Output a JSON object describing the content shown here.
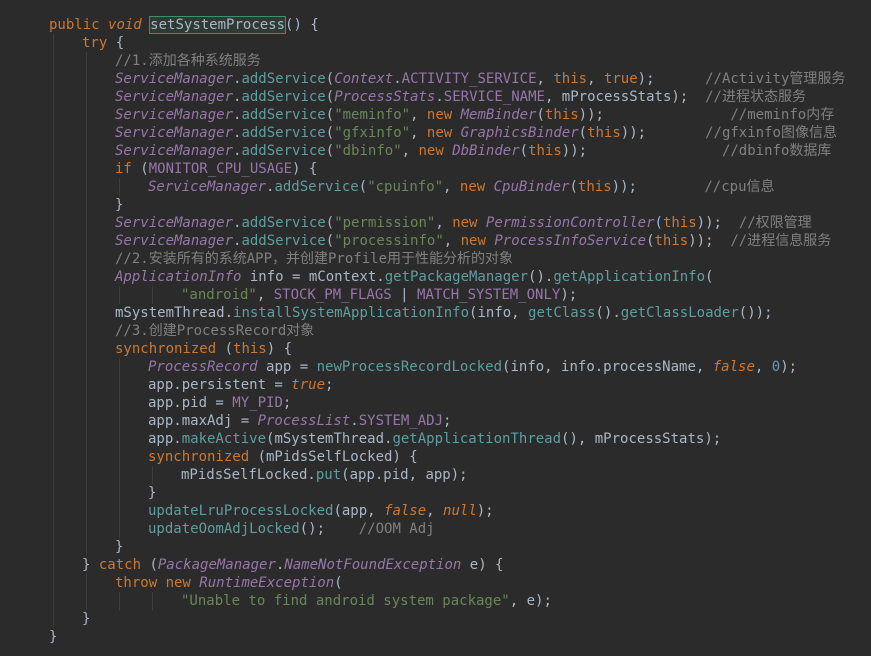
{
  "editor": {
    "background": "#2b2b2b",
    "colors": {
      "keyword": "#cc7832",
      "class": "#9876aa",
      "method": "#5f9ea0",
      "string": "#6a8759",
      "comment": "#808080",
      "number": "#6897bb",
      "plain": "#a9b7c6"
    },
    "lines": [
      {
        "indent": 0,
        "tokens": [
          [
            "kw",
            "public "
          ],
          [
            "kwi",
            "void "
          ],
          [
            "hl",
            "setSystemProcess"
          ],
          [
            "plain",
            "() {"
          ]
        ]
      },
      {
        "indent": 1,
        "tokens": [
          [
            "kw",
            "try "
          ],
          [
            "plain",
            "{"
          ]
        ]
      },
      {
        "indent": 2,
        "tokens": [
          [
            "cmt",
            "//1.添加各种系统服务"
          ]
        ]
      },
      {
        "indent": 2,
        "tokens": [
          [
            "cls",
            "ServiceManager"
          ],
          [
            "plain",
            "."
          ],
          [
            "meth",
            "addService"
          ],
          [
            "plain",
            "("
          ],
          [
            "cls",
            "Context"
          ],
          [
            "plain",
            "."
          ],
          [
            "const",
            "ACTIVITY_SERVICE"
          ],
          [
            "plain",
            ", "
          ],
          [
            "kw",
            "this"
          ],
          [
            "plain",
            ", "
          ],
          [
            "kw",
            "true"
          ],
          [
            "plain",
            ");      "
          ],
          [
            "cmt",
            "//Activity管理服务"
          ]
        ]
      },
      {
        "indent": 2,
        "tokens": [
          [
            "cls",
            "ServiceManager"
          ],
          [
            "plain",
            "."
          ],
          [
            "meth",
            "addService"
          ],
          [
            "plain",
            "("
          ],
          [
            "cls",
            "ProcessStats"
          ],
          [
            "plain",
            "."
          ],
          [
            "const",
            "SERVICE_NAME"
          ],
          [
            "plain",
            ", mProcessStats);  "
          ],
          [
            "cmt",
            "//进程状态服务"
          ]
        ]
      },
      {
        "indent": 2,
        "tokens": [
          [
            "cls",
            "ServiceManager"
          ],
          [
            "plain",
            "."
          ],
          [
            "meth",
            "addService"
          ],
          [
            "plain",
            "("
          ],
          [
            "str",
            "\"meminfo\""
          ],
          [
            "plain",
            ", "
          ],
          [
            "kw",
            "new "
          ],
          [
            "cls",
            "MemBinder"
          ],
          [
            "plain",
            "("
          ],
          [
            "kw",
            "this"
          ],
          [
            "plain",
            "));               "
          ],
          [
            "cmt",
            "//meminfo内存"
          ]
        ]
      },
      {
        "indent": 2,
        "tokens": [
          [
            "cls",
            "ServiceManager"
          ],
          [
            "plain",
            "."
          ],
          [
            "meth",
            "addService"
          ],
          [
            "plain",
            "("
          ],
          [
            "str",
            "\"gfxinfo\""
          ],
          [
            "plain",
            ", "
          ],
          [
            "kw",
            "new "
          ],
          [
            "cls",
            "GraphicsBinder"
          ],
          [
            "plain",
            "("
          ],
          [
            "kw",
            "this"
          ],
          [
            "plain",
            "));       "
          ],
          [
            "cmt",
            "//gfxinfo图像信息"
          ]
        ]
      },
      {
        "indent": 2,
        "tokens": [
          [
            "cls",
            "ServiceManager"
          ],
          [
            "plain",
            "."
          ],
          [
            "meth",
            "addService"
          ],
          [
            "plain",
            "("
          ],
          [
            "str",
            "\"dbinfo\""
          ],
          [
            "plain",
            ", "
          ],
          [
            "kw",
            "new "
          ],
          [
            "cls",
            "DbBinder"
          ],
          [
            "plain",
            "("
          ],
          [
            "kw",
            "this"
          ],
          [
            "plain",
            "));                "
          ],
          [
            "cmt",
            "//dbinfo数据库"
          ]
        ]
      },
      {
        "indent": 2,
        "tokens": [
          [
            "kw",
            "if "
          ],
          [
            "plain",
            "("
          ],
          [
            "const",
            "MONITOR_CPU_USAGE"
          ],
          [
            "plain",
            ") {"
          ]
        ]
      },
      {
        "indent": 3,
        "tokens": [
          [
            "cls",
            "ServiceManager"
          ],
          [
            "plain",
            "."
          ],
          [
            "meth",
            "addService"
          ],
          [
            "plain",
            "("
          ],
          [
            "str",
            "\"cpuinfo\""
          ],
          [
            "plain",
            ", "
          ],
          [
            "kw",
            "new "
          ],
          [
            "cls",
            "CpuBinder"
          ],
          [
            "plain",
            "("
          ],
          [
            "kw",
            "this"
          ],
          [
            "plain",
            "));        "
          ],
          [
            "cmt",
            "//cpu信息"
          ]
        ]
      },
      {
        "indent": 2,
        "tokens": [
          [
            "plain",
            "}"
          ]
        ]
      },
      {
        "indent": 2,
        "tokens": [
          [
            "cls",
            "ServiceManager"
          ],
          [
            "plain",
            "."
          ],
          [
            "meth",
            "addService"
          ],
          [
            "plain",
            "("
          ],
          [
            "str",
            "\"permission\""
          ],
          [
            "plain",
            ", "
          ],
          [
            "kw",
            "new "
          ],
          [
            "cls",
            "PermissionController"
          ],
          [
            "plain",
            "("
          ],
          [
            "kw",
            "this"
          ],
          [
            "plain",
            "));  "
          ],
          [
            "cmt",
            "//权限管理"
          ]
        ]
      },
      {
        "indent": 2,
        "tokens": [
          [
            "cls",
            "ServiceManager"
          ],
          [
            "plain",
            "."
          ],
          [
            "meth",
            "addService"
          ],
          [
            "plain",
            "("
          ],
          [
            "str",
            "\"processinfo\""
          ],
          [
            "plain",
            ", "
          ],
          [
            "kw",
            "new "
          ],
          [
            "cls",
            "ProcessInfoService"
          ],
          [
            "plain",
            "("
          ],
          [
            "kw",
            "this"
          ],
          [
            "plain",
            "));  "
          ],
          [
            "cmt",
            "//进程信息服务"
          ]
        ]
      },
      {
        "indent": 2,
        "tokens": [
          [
            "cmt",
            "//2.安装所有的系统APP，并创建Profile用于性能分析的对象"
          ]
        ]
      },
      {
        "indent": 2,
        "tokens": [
          [
            "cls",
            "ApplicationInfo "
          ],
          [
            "plain",
            "info = mContext."
          ],
          [
            "meth",
            "getPackageManager"
          ],
          [
            "plain",
            "()."
          ],
          [
            "meth",
            "getApplicationInfo"
          ],
          [
            "plain",
            "("
          ]
        ]
      },
      {
        "indent": 4,
        "tokens": [
          [
            "str",
            "\"android\""
          ],
          [
            "plain",
            ", "
          ],
          [
            "const",
            "STOCK_PM_FLAGS"
          ],
          [
            "plain",
            " | "
          ],
          [
            "const",
            "MATCH_SYSTEM_ONLY"
          ],
          [
            "plain",
            ");"
          ]
        ]
      },
      {
        "indent": 2,
        "tokens": [
          [
            "plain",
            "mSystemThread."
          ],
          [
            "meth",
            "installSystemApplicationInfo"
          ],
          [
            "plain",
            "(info, "
          ],
          [
            "meth",
            "getClass"
          ],
          [
            "plain",
            "()."
          ],
          [
            "meth",
            "getClassLoader"
          ],
          [
            "plain",
            "());"
          ]
        ]
      },
      {
        "indent": 2,
        "tokens": [
          [
            "cmt",
            "//3.创建ProcessRecord对象"
          ]
        ]
      },
      {
        "indent": 2,
        "tokens": [
          [
            "kw",
            "synchronized "
          ],
          [
            "plain",
            "("
          ],
          [
            "kw",
            "this"
          ],
          [
            "plain",
            ") {"
          ]
        ]
      },
      {
        "indent": 3,
        "tokens": [
          [
            "cls",
            "ProcessRecord "
          ],
          [
            "plain",
            "app = "
          ],
          [
            "meth",
            "newProcessRecordLocked"
          ],
          [
            "plain",
            "(info, info.processName, "
          ],
          [
            "kwi",
            "false"
          ],
          [
            "plain",
            ", "
          ],
          [
            "num",
            "0"
          ],
          [
            "plain",
            ");"
          ]
        ]
      },
      {
        "indent": 3,
        "tokens": [
          [
            "plain",
            "app.persistent = "
          ],
          [
            "kwi",
            "true"
          ],
          [
            "plain",
            ";"
          ]
        ]
      },
      {
        "indent": 3,
        "tokens": [
          [
            "plain",
            "app.pid = "
          ],
          [
            "const",
            "MY_PID"
          ],
          [
            "plain",
            ";"
          ]
        ]
      },
      {
        "indent": 3,
        "tokens": [
          [
            "plain",
            "app.maxAdj = "
          ],
          [
            "cls",
            "ProcessList"
          ],
          [
            "plain",
            "."
          ],
          [
            "const",
            "SYSTEM_ADJ"
          ],
          [
            "plain",
            ";"
          ]
        ]
      },
      {
        "indent": 3,
        "tokens": [
          [
            "plain",
            "app."
          ],
          [
            "meth",
            "makeActive"
          ],
          [
            "plain",
            "(mSystemThread."
          ],
          [
            "meth",
            "getApplicationThread"
          ],
          [
            "plain",
            "(), mProcessStats);"
          ]
        ]
      },
      {
        "indent": 3,
        "tokens": [
          [
            "kw",
            "synchronized "
          ],
          [
            "plain",
            "(mPidsSelfLocked) {"
          ]
        ]
      },
      {
        "indent": 4,
        "tokens": [
          [
            "plain",
            "mPidsSelfLocked."
          ],
          [
            "meth",
            "put"
          ],
          [
            "plain",
            "(app.pid, app);"
          ]
        ]
      },
      {
        "indent": 3,
        "tokens": [
          [
            "plain",
            "}"
          ]
        ]
      },
      {
        "indent": 3,
        "tokens": [
          [
            "meth",
            "updateLruProcessLocked"
          ],
          [
            "plain",
            "(app, "
          ],
          [
            "kwi",
            "false"
          ],
          [
            "plain",
            ", "
          ],
          [
            "kwi",
            "null"
          ],
          [
            "plain",
            ");"
          ]
        ]
      },
      {
        "indent": 3,
        "tokens": [
          [
            "meth",
            "updateOomAdjLocked"
          ],
          [
            "plain",
            "();    "
          ],
          [
            "cmt",
            "//OOM Adj"
          ]
        ]
      },
      {
        "indent": 2,
        "tokens": [
          [
            "plain",
            "}"
          ]
        ]
      },
      {
        "indent": 1,
        "tokens": [
          [
            "plain",
            "} "
          ],
          [
            "kw",
            "catch "
          ],
          [
            "plain",
            "("
          ],
          [
            "cls",
            "PackageManager"
          ],
          [
            "plain",
            "."
          ],
          [
            "cls",
            "NameNotFoundException "
          ],
          [
            "plain",
            "e) {"
          ]
        ]
      },
      {
        "indent": 2,
        "tokens": [
          [
            "kw",
            "throw new "
          ],
          [
            "cls",
            "RuntimeException"
          ],
          [
            "plain",
            "("
          ]
        ]
      },
      {
        "indent": 4,
        "tokens": [
          [
            "str",
            "\"Unable to find android system package\""
          ],
          [
            "plain",
            ", e);"
          ]
        ]
      },
      {
        "indent": 1,
        "tokens": [
          [
            "plain",
            "}"
          ]
        ]
      },
      {
        "indent": 0,
        "tokens": [
          [
            "plain",
            "}"
          ]
        ]
      }
    ]
  }
}
